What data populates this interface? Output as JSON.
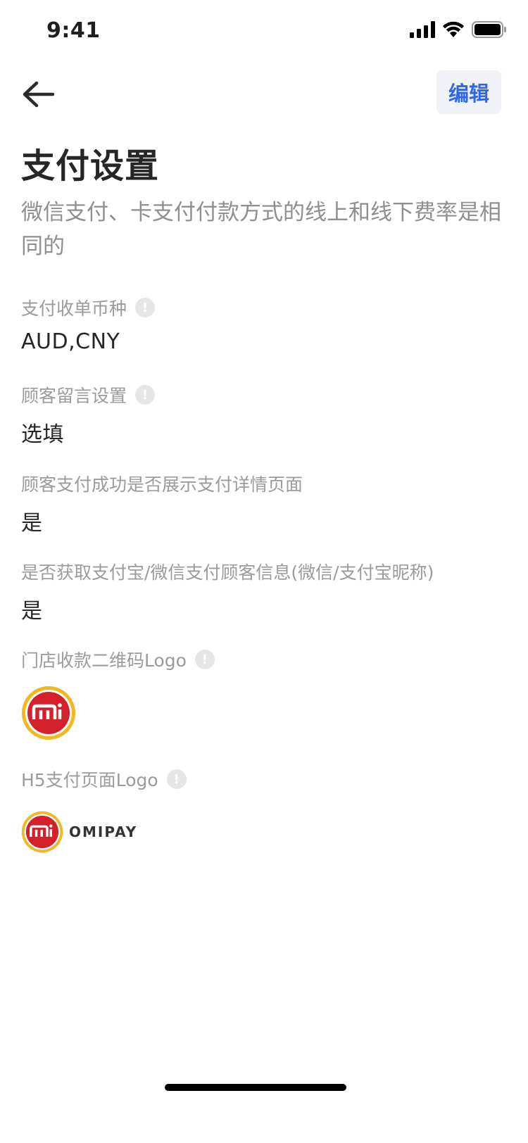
{
  "status_bar": {
    "time": "9:41"
  },
  "nav": {
    "edit_label": "编辑"
  },
  "page": {
    "title": "支付设置",
    "description": "微信支付、卡支付付款方式的线上和线下费率是相同的"
  },
  "fields": [
    {
      "label": "支付收单币种",
      "value": "AUD,CNY",
      "has_info": true
    },
    {
      "label": "顾客留言设置",
      "value": "选填",
      "has_info": true
    },
    {
      "label": "顾客支付成功是否展示支付详情页面",
      "value": "是",
      "has_info": false
    },
    {
      "label": "是否获取支付宝/微信支付顾客信息(微信/支付宝昵称)",
      "value": "是",
      "has_info": false
    },
    {
      "label": "门店收款二维码Logo",
      "logo": "mi-round-logo",
      "has_info": true
    },
    {
      "label": "H5支付页面Logo",
      "logo": "omipay-logo",
      "logo_text": "OMIPAY",
      "has_info": true
    }
  ],
  "info_icon_glyph": "!",
  "colors": {
    "accent": "#2f67e9",
    "logo_red": "#d4202a",
    "logo_gold": "#f2b821"
  }
}
